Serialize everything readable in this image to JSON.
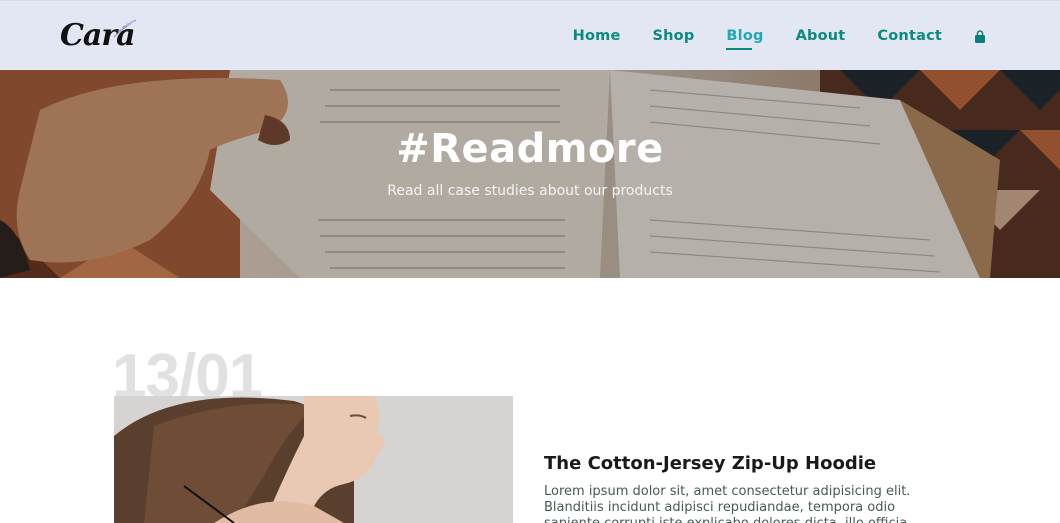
{
  "header": {
    "logo_text": "Cara",
    "nav": [
      {
        "label": "Home"
      },
      {
        "label": "Shop"
      },
      {
        "label": "Blog"
      },
      {
        "label": "About"
      },
      {
        "label": "Contact"
      }
    ],
    "active_nav": "Blog",
    "cart_icon": "shopping-bag-icon",
    "background": "#e3e6f3",
    "accent": "#088178"
  },
  "hero": {
    "title": "#Readmore",
    "subtitle": "Read all case studies about our products"
  },
  "blog": {
    "posts": [
      {
        "date": "13/01",
        "title": "The Cotton-Jersey Zip-Up Hoodie",
        "excerpt": "Lorem ipsum dolor sit, amet consectetur adipisicing elit. Blanditiis incidunt adipisci repudiandae, tempora odio sapiente corrupti iste explicabo dolores dicta, illo officia"
      }
    ]
  }
}
